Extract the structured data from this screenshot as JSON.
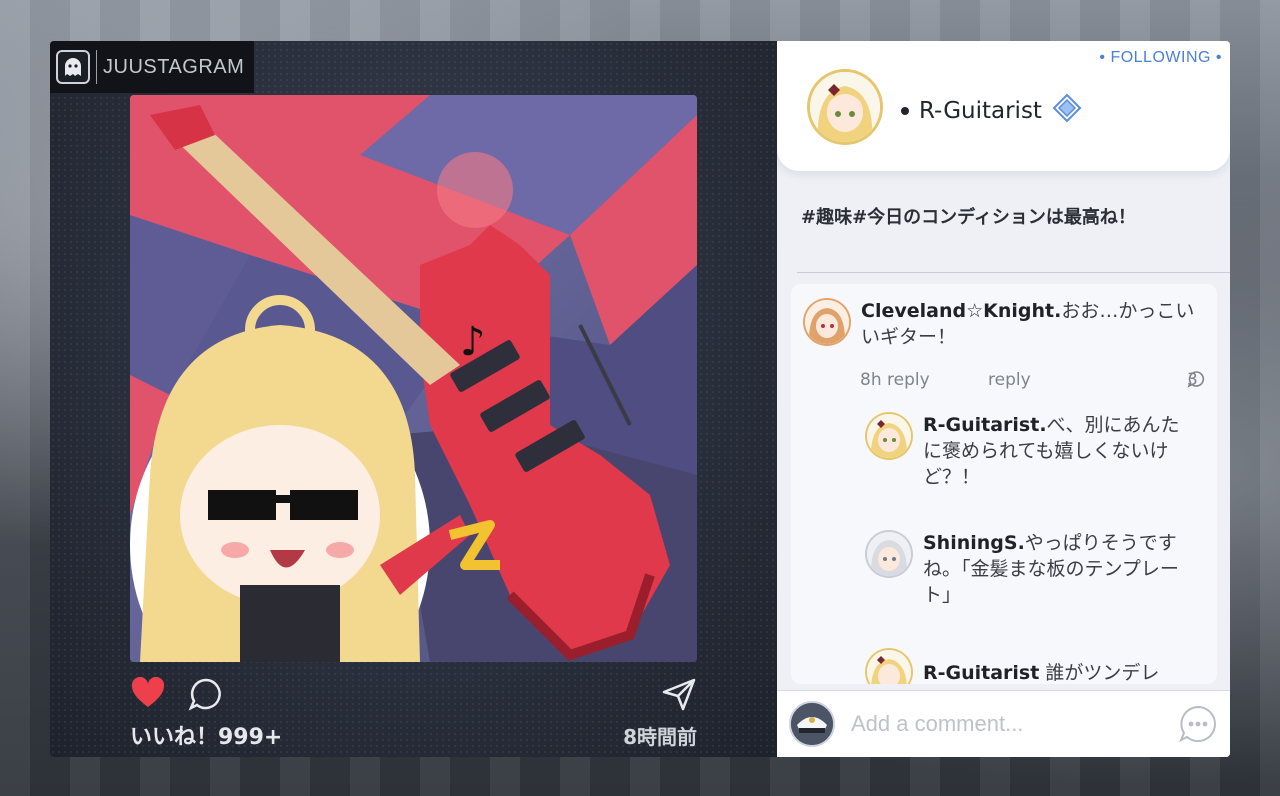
{
  "brand": {
    "name": "JUUSTAGRAM",
    "icon": "ghost-logo-icon"
  },
  "post": {
    "likes_label": "いいね！999+",
    "time_ago": "8時間前",
    "liked": true,
    "icons": [
      "heart-icon",
      "comment-icon",
      "send-icon"
    ]
  },
  "profile": {
    "following_label": "• FOLLOWING •",
    "name": "R-Guitarist",
    "verified_icon": "diamond-verified-icon"
  },
  "caption": "#趣味#今日のコンディションは最高ね！",
  "comments": [
    {
      "author": "Cleveland☆Knight.",
      "text": "おお…かっこいいギター！",
      "meta_time": "8h reply",
      "meta_reply": "reply",
      "reply_count": "3"
    },
    {
      "author": "R-Guitarist.",
      "text": "べ、別にあんたに褒められても嬉しくないけど？！"
    },
    {
      "author": "ShiningS.",
      "text": "やっぱりそうですね。「金髪まな板のテンプレート」"
    },
    {
      "author": "R-Guitarist",
      "text": " 誰がツンデレ"
    }
  ],
  "input": {
    "placeholder": "Add a comment..."
  },
  "colors": {
    "accent": "#4a7fd8",
    "like_red": "#ee3f4d",
    "panel_bg": "#eef0f6",
    "post_bg": "#252a36"
  }
}
